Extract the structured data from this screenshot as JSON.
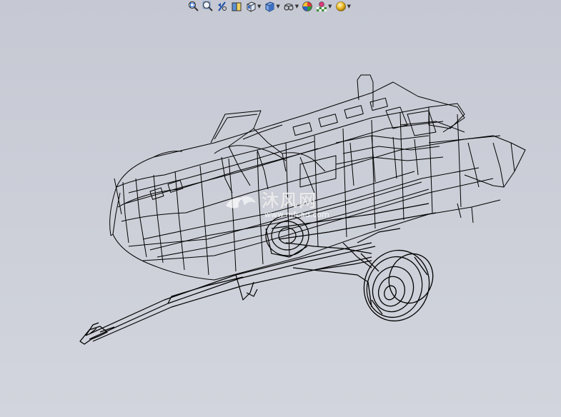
{
  "toolbar": {
    "buttons": [
      {
        "icon": "zoom-to-fit-icon",
        "has_dropdown": false
      },
      {
        "icon": "zoom-to-area-icon",
        "has_dropdown": false
      },
      {
        "icon": "previous-view-icon",
        "has_dropdown": false
      },
      {
        "icon": "section-view-icon",
        "has_dropdown": false
      },
      {
        "icon": "view-orientation-icon",
        "has_dropdown": true
      },
      {
        "icon": "display-style-icon",
        "has_dropdown": true
      },
      {
        "icon": "hide-show-items-icon",
        "has_dropdown": true
      },
      {
        "icon": "edit-appearance-icon",
        "has_dropdown": false
      },
      {
        "icon": "apply-scene-icon",
        "has_dropdown": true
      },
      {
        "icon": "view-settings-icon",
        "has_dropdown": true
      }
    ]
  },
  "viewport": {
    "background": "#c9ccd6",
    "model_line_color": "#000000"
  },
  "watermark": {
    "text": "沐风网",
    "url": "www.mfcad.com"
  }
}
